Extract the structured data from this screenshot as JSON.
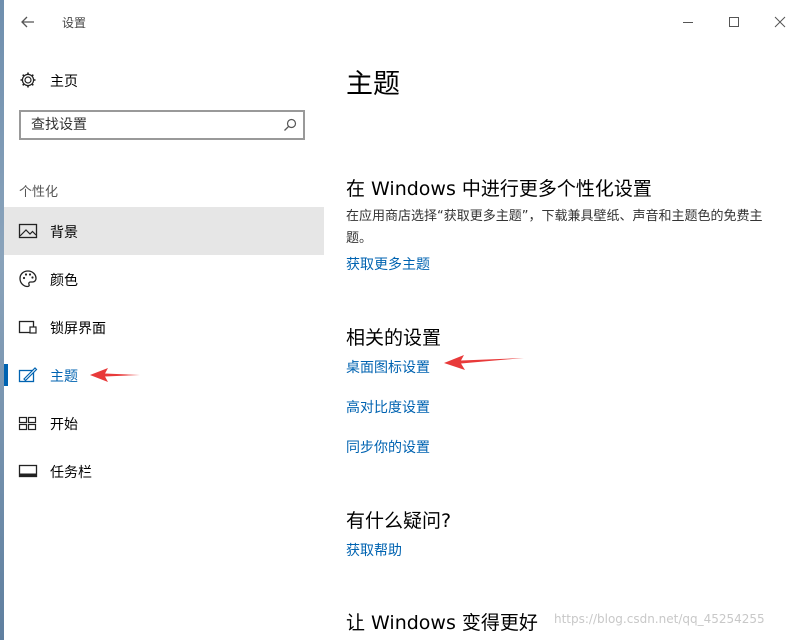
{
  "window": {
    "title": "设置",
    "back_icon": "back-arrow-icon",
    "controls": [
      "minimize-icon",
      "maximize-icon",
      "close-icon"
    ]
  },
  "sidebar": {
    "home_label": "主页",
    "search_placeholder": "查找设置",
    "section_label": "个性化",
    "items": [
      {
        "label": "背景",
        "icon": "picture-icon",
        "state": "hover"
      },
      {
        "label": "颜色",
        "icon": "palette-icon",
        "state": "normal"
      },
      {
        "label": "锁屏界面",
        "icon": "lockscreen-icon",
        "state": "normal"
      },
      {
        "label": "主题",
        "icon": "theme-brush-icon",
        "state": "selected"
      },
      {
        "label": "开始",
        "icon": "start-tiles-icon",
        "state": "normal"
      },
      {
        "label": "任务栏",
        "icon": "taskbar-icon",
        "state": "normal"
      }
    ]
  },
  "main": {
    "title": "主题",
    "more_section": {
      "heading": "在 Windows 中进行更多个性化设置",
      "description": "在应用商店选择“获取更多主题”，下载兼具壁纸、声音和主题色的免费主题。",
      "link": "获取更多主题"
    },
    "related_section": {
      "heading": "相关的设置",
      "links": [
        "桌面图标设置",
        "高对比度设置",
        "同步你的设置"
      ]
    },
    "help_section": {
      "heading": "有什么疑问?",
      "link": "获取帮助"
    },
    "better_section": {
      "heading": "让 Windows 变得更好"
    }
  },
  "watermark": "https://blog.csdn.net/qq_45254255",
  "colors": {
    "accent": "#0063b1",
    "annotation_arrow": "#e83a3a",
    "hover_bg": "#e6e6e6"
  }
}
